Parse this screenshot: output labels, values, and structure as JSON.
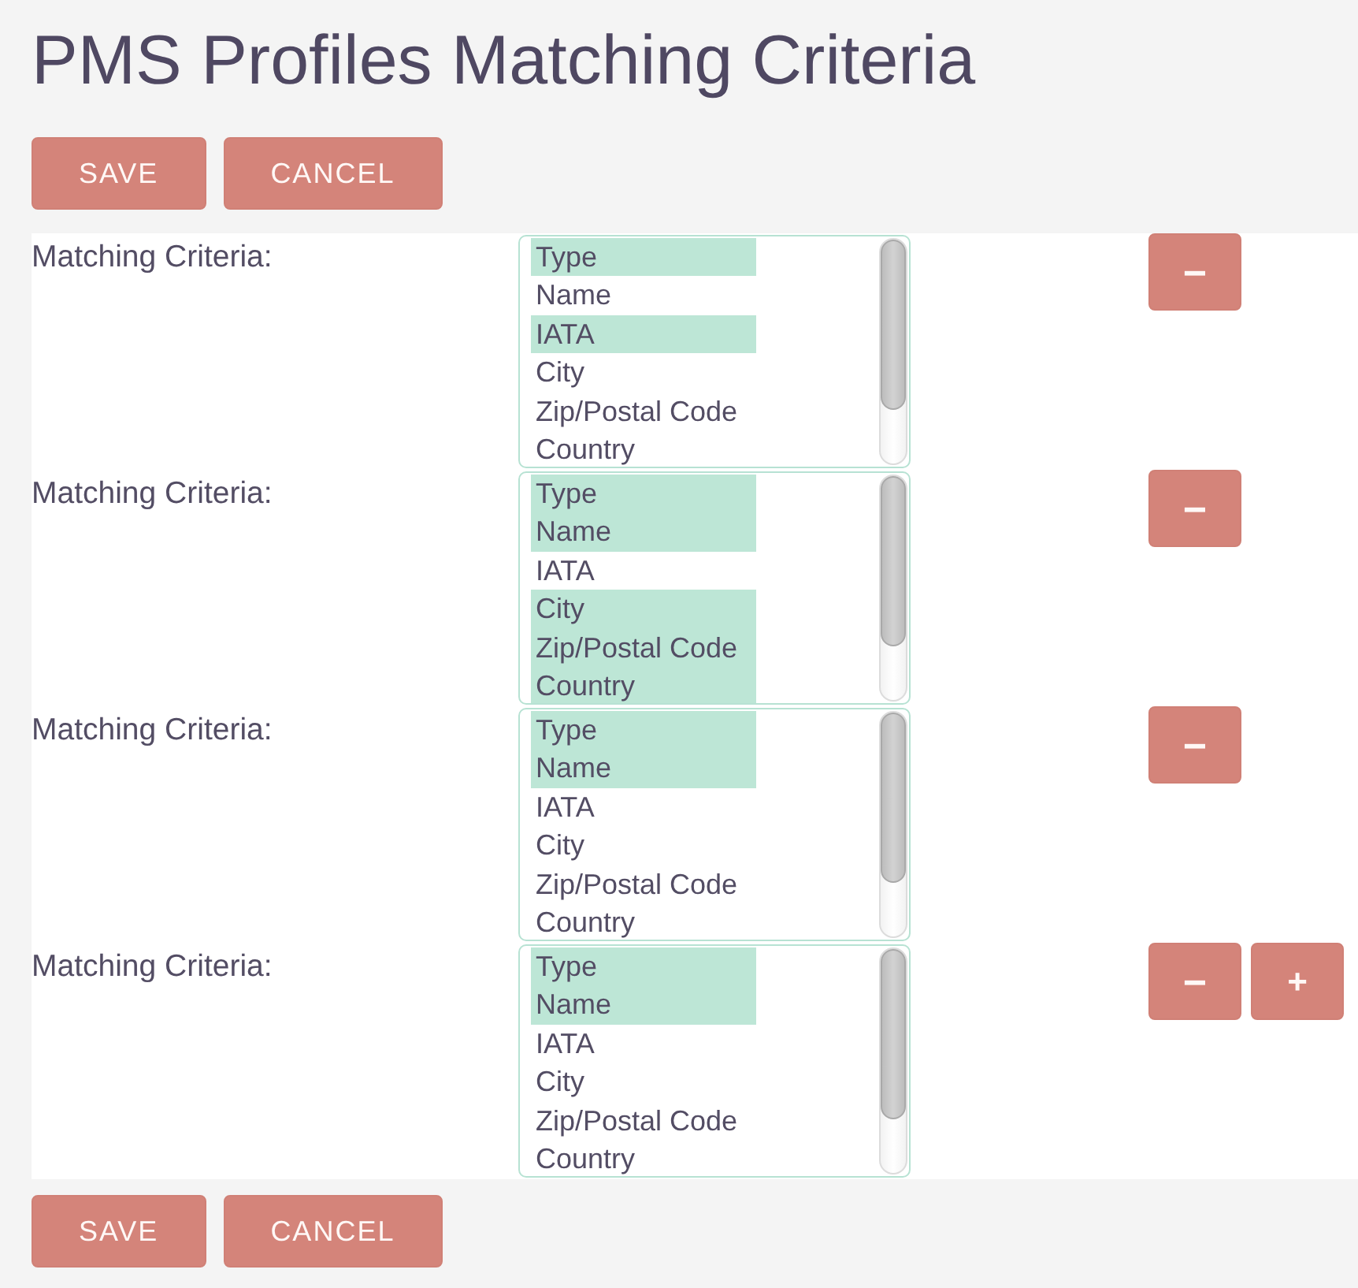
{
  "title": "PMS Profiles Matching Criteria",
  "top_buttons": [
    "SAVE",
    "CANCEL"
  ],
  "criteria": [
    {
      "label": "Matching Criteria:",
      "options": [
        {
          "label": "Type",
          "selected": true
        },
        {
          "label": "Name",
          "selected": false
        },
        {
          "label": "IATA",
          "selected": true
        },
        {
          "label": "City",
          "selected": false
        },
        {
          "label": "Zip/Postal Code",
          "selected": false
        },
        {
          "label": "Country",
          "selected": false
        }
      ],
      "buttons": [
        {
          "label": "−",
          "kind": "remove"
        }
      ]
    },
    {
      "label": "Matching Criteria:",
      "options": [
        {
          "label": "Type",
          "selected": true
        },
        {
          "label": "Name",
          "selected": true
        },
        {
          "label": "IATA",
          "selected": false
        },
        {
          "label": "City",
          "selected": true
        },
        {
          "label": "Zip/Postal Code",
          "selected": true
        },
        {
          "label": "Country",
          "selected": true
        }
      ],
      "buttons": [
        {
          "label": "−",
          "kind": "remove"
        }
      ]
    },
    {
      "label": "Matching Criteria:",
      "options": [
        {
          "label": "Type",
          "selected": true
        },
        {
          "label": "Name",
          "selected": true
        },
        {
          "label": "IATA",
          "selected": false
        },
        {
          "label": "City",
          "selected": false
        },
        {
          "label": "Zip/Postal Code",
          "selected": false
        },
        {
          "label": "Country",
          "selected": false
        }
      ],
      "buttons": [
        {
          "label": "−",
          "kind": "remove"
        }
      ]
    },
    {
      "label": "Matching Criteria:",
      "options": [
        {
          "label": "Type",
          "selected": true
        },
        {
          "label": "Name",
          "selected": true
        },
        {
          "label": "IATA",
          "selected": false
        },
        {
          "label": "City",
          "selected": false
        },
        {
          "label": "Zip/Postal Code",
          "selected": false
        },
        {
          "label": "Country",
          "selected": false
        }
      ],
      "buttons": [
        {
          "label": "−",
          "kind": "remove"
        },
        {
          "label": "+",
          "kind": "add"
        }
      ]
    }
  ],
  "bottom_buttons": [
    "SAVE",
    "CANCEL"
  ]
}
